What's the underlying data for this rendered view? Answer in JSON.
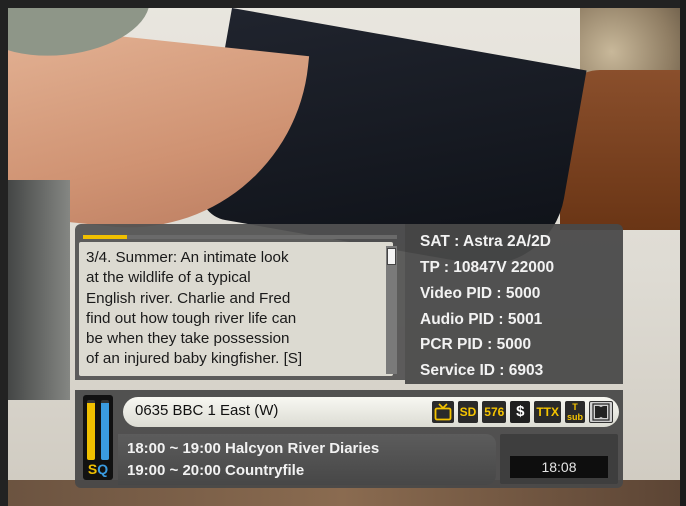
{
  "description": {
    "text": "3/4. Summer: An intimate look at the wildlife of a typical English river. Charlie and Fred find out how tough river life can be when they take possession of an injured baby kingfisher. [S]",
    "lines": [
      "3/4. Summer: An intimate look",
      "at the wildlife of a typical",
      "English river. Charlie and Fred",
      "find out how tough river life can",
      "be when they take possession",
      "of an injured baby kingfisher. [S]"
    ],
    "progress_fraction": 0.14
  },
  "tech_info": {
    "lines": [
      "SAT : Astra 2A/2D",
      "TP : 10847V 22000",
      "Video PID : 5000",
      "Audio PID : 5001",
      "PCR PID : 5000",
      "Service ID : 6903"
    ]
  },
  "signal": {
    "label_s": "S",
    "label_q": "Q",
    "strength_fraction": 0.95,
    "quality_fraction": 0.95,
    "strength_color": "#f0c000",
    "quality_color": "#3a9be0"
  },
  "channel": {
    "name": "0635 BBC 1 East (W)",
    "icons": {
      "tv": "tv-icon",
      "sd": "SD",
      "resolution": "576",
      "scrambled": "$",
      "teletext": "TTX",
      "subtitle_top": "T",
      "subtitle_bottom": "sub",
      "dolby": "DD"
    }
  },
  "events": {
    "now": "18:00 ~ 19:00  Halcyon River Diaries",
    "next": "19:00 ~ 20:00  Countryfile"
  },
  "clock": "18:08",
  "colors": {
    "accent_yellow": "#f0c000",
    "panel_gray": "#4a4a4a"
  }
}
